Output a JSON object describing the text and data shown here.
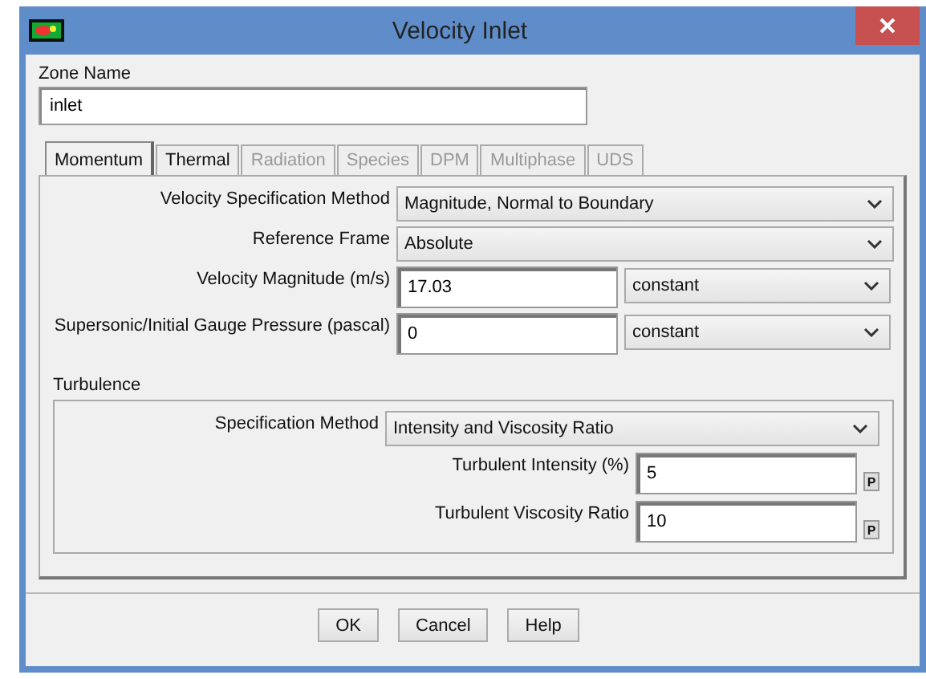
{
  "window": {
    "title": "Velocity Inlet"
  },
  "zone_name": {
    "label": "Zone Name",
    "value": "inlet"
  },
  "tabs": [
    {
      "label": "Momentum",
      "selected": true,
      "disabled": false
    },
    {
      "label": "Thermal",
      "selected": false,
      "disabled": false
    },
    {
      "label": "Radiation",
      "selected": false,
      "disabled": true
    },
    {
      "label": "Species",
      "selected": false,
      "disabled": true
    },
    {
      "label": "DPM",
      "selected": false,
      "disabled": true
    },
    {
      "label": "Multiphase",
      "selected": false,
      "disabled": true
    },
    {
      "label": "UDS",
      "selected": false,
      "disabled": true
    }
  ],
  "momentum": [
    {
      "kind": "select",
      "label": "Velocity Specification Method",
      "value": "Magnitude, Normal to Boundary"
    },
    {
      "kind": "select",
      "label": "Reference Frame",
      "value": "Absolute"
    },
    {
      "kind": "input_select",
      "label": "Velocity Magnitude (m/s)",
      "value": "17.03",
      "option": "constant"
    },
    {
      "kind": "input_select",
      "label": "Supersonic/Initial Gauge Pressure (pascal)",
      "value": "0",
      "option": "constant"
    }
  ],
  "turbulence": {
    "label": "Turbulence",
    "rows": [
      {
        "kind": "select",
        "label": "Specification Method",
        "value": "Intensity and Viscosity Ratio"
      },
      {
        "kind": "input_param",
        "label": "Turbulent Intensity (%)",
        "value": "5",
        "param": "P"
      },
      {
        "kind": "input_param",
        "label": "Turbulent Viscosity Ratio",
        "value": "10",
        "param": "P"
      }
    ]
  },
  "buttons": [
    "OK",
    "Cancel",
    "Help"
  ]
}
